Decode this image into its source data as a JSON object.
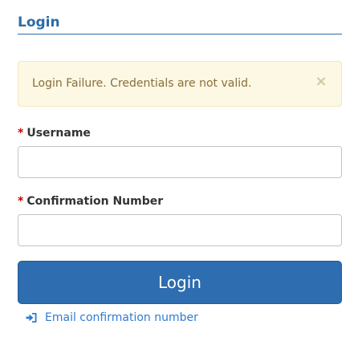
{
  "form": {
    "heading": "Login",
    "alert": {
      "message": "Login Failure. Credentials are not valid.",
      "close_glyph": "×",
      "close_icon": "close-icon",
      "color": "#8a6d3b",
      "background": "#fcf8e3"
    },
    "username": {
      "required_mark": "*",
      "label": "Username",
      "value": ""
    },
    "confirmation": {
      "required_mark": "*",
      "label": "Confirmation Number",
      "value": ""
    },
    "submit_label": "Login",
    "email_link": {
      "icon": "sign-in-icon",
      "label": "Email confirmation number"
    },
    "colors": {
      "accent": "#2d6ba8",
      "button": "#2d6db0",
      "required": "#cc0000",
      "link": "#2f7bd0"
    }
  }
}
